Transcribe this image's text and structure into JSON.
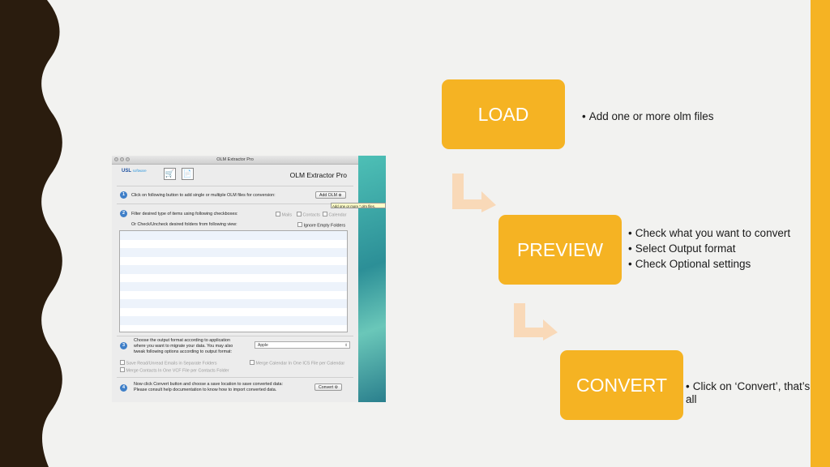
{
  "colors": {
    "accent": "#f5b323",
    "background": "#f2f2f0",
    "wave": "#2a1c0e"
  },
  "window": {
    "title": "OLM Extractor Pro",
    "app_title": "OLM Extractor Pro",
    "logo_brand": "USL",
    "logo_sub": "software",
    "icons": [
      "cart-icon",
      "pdf-help-icon"
    ],
    "step1": {
      "number": "1",
      "text": "Click on following button to add single or multiple OLM files for conversion:",
      "button": "Add OLM",
      "tooltip": "Add one or more *.olm files."
    },
    "step2": {
      "number": "2",
      "text": "Filter desired type of items using following checkboxes:",
      "filters": [
        "Mails",
        "Contacts",
        "Calendar"
      ],
      "text2": "Or Check/Uncheck desired folders from following view:",
      "ignore_empty": "Ignore Empty Folders"
    },
    "step3": {
      "number": "3",
      "line1": "Choose the output format according to application",
      "line2": "where you want to migrate your data. You may also",
      "line3": "tweak following options according to output format:",
      "format": "Apple",
      "opt_read_unread": "Save Read/Unread Emails in Separate Folders",
      "opt_merge_calendar": "Merge Calendar In One ICS File per Calendar",
      "opt_merge_contacts": "Merge Contacts In One VCF File per Contacts Folder"
    },
    "step4": {
      "number": "4",
      "line1": "Now click Convert button and choose a save location to save converted data:",
      "line2": "Please consult help documentation to know how to import converted data.",
      "button": "Convert"
    }
  },
  "steps": [
    {
      "label": "LOAD",
      "bullets": [
        "Add one or more olm files"
      ]
    },
    {
      "label": "PREVIEW",
      "bullets": [
        "Check what you want to convert",
        "Select Output format",
        "Check Optional settings"
      ]
    },
    {
      "label": "CONVERT",
      "bullets": [
        "Click on ‘Convert’, that’s all"
      ]
    }
  ]
}
